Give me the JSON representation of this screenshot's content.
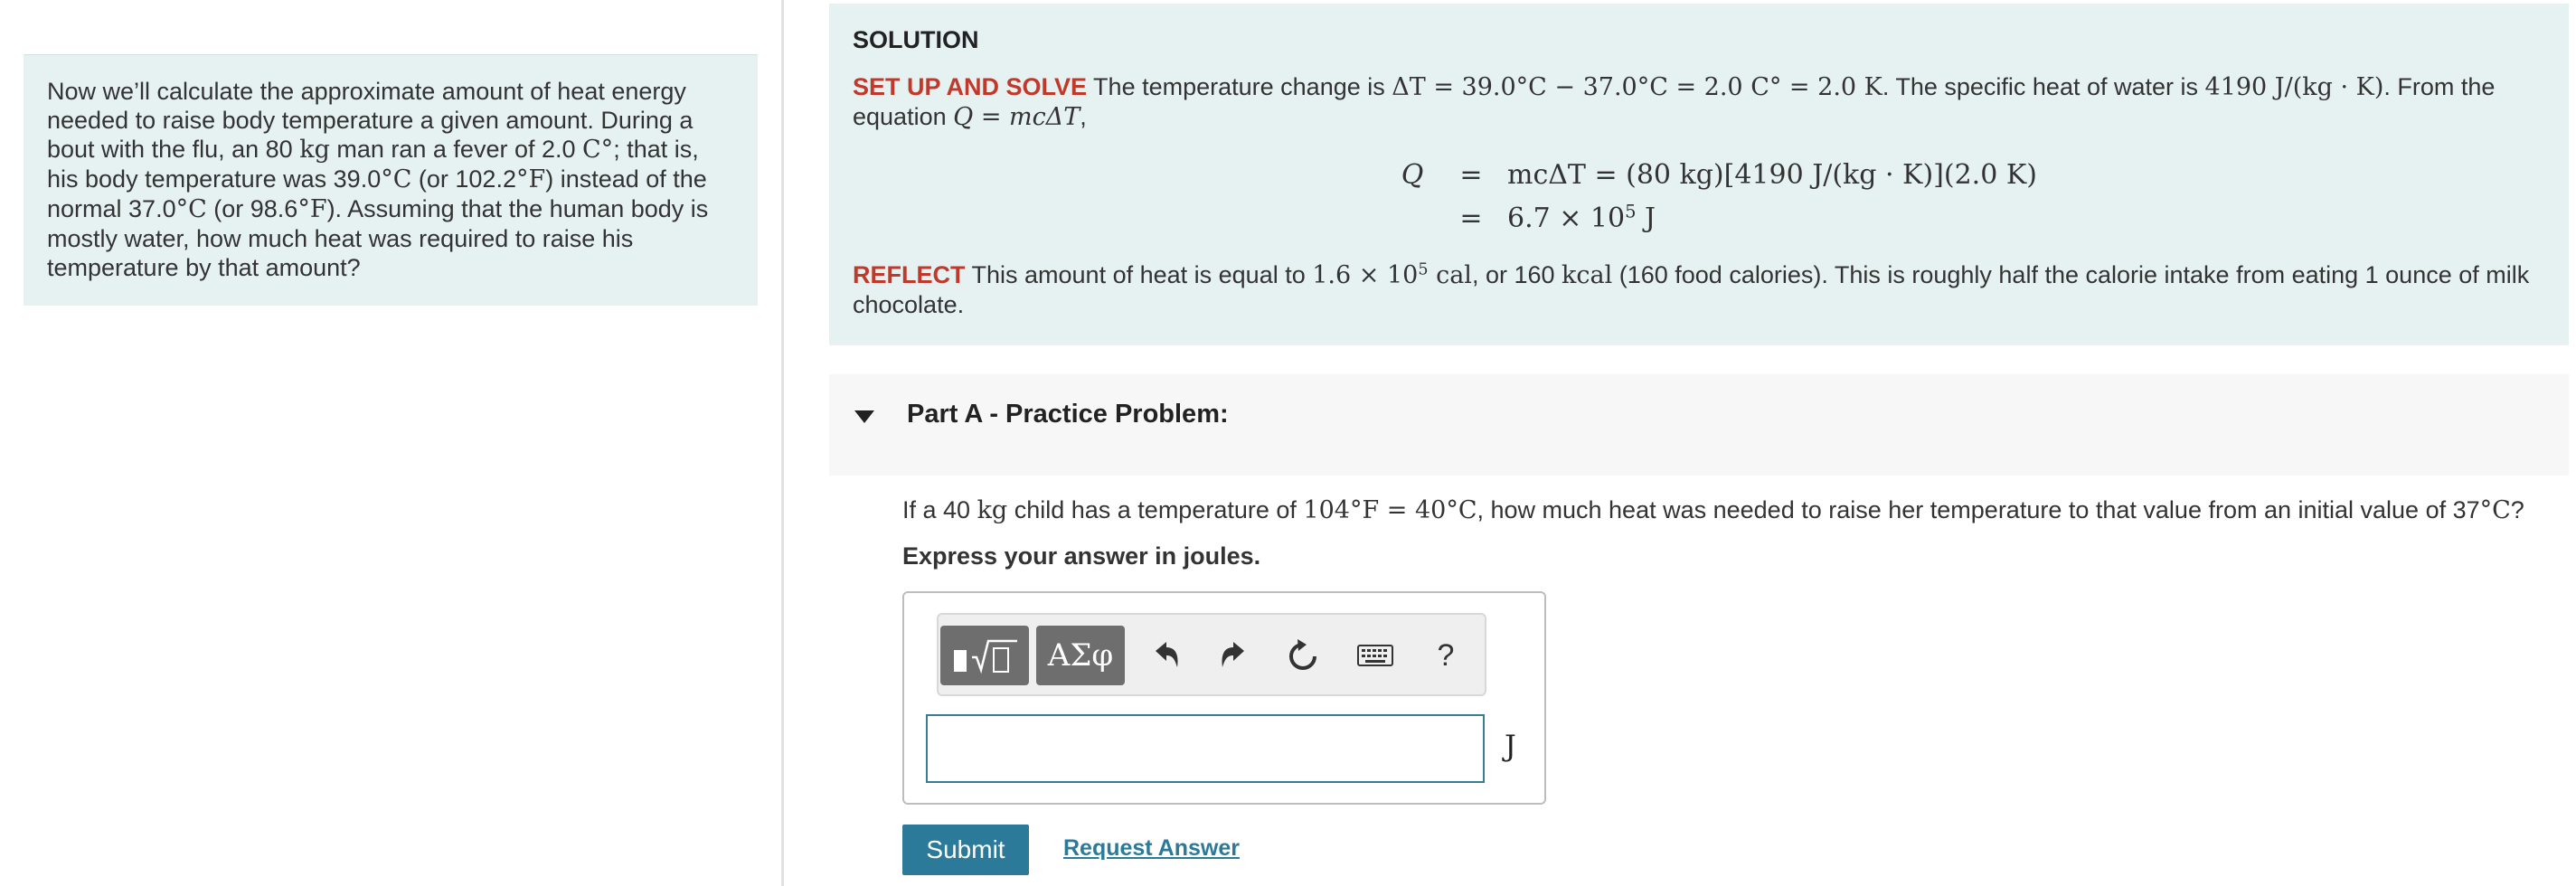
{
  "problem": {
    "t1": "Now we’ll calculate the approximate amount of heat energy needed to raise body temperature a given amount. During a bout with the flu, an 80 ",
    "kg": "kg",
    "t2": " man ran a fever of 2.0 ",
    "cdeg": "C°",
    "t3": "; that is, his body temperature was 39.0",
    "degC1": "°C",
    "t4": " (or 102.2",
    "degF": "°F",
    "t5": ") instead of the normal 37.0",
    "degC2": "°C",
    "t6": " (or 98.6",
    "degF2": "°F",
    "t7": "). Assuming that the human body is mostly water, how much heat was required to raise his temperature by that amount?"
  },
  "solution": {
    "title": "SOLUTION",
    "setup_label": "SET UP AND SOLVE",
    "setup_t1": " The temperature change is ",
    "delta_expr": "ΔT = 39.0°C − 37.0°C = 2.0 C° = 2.0 K",
    "setup_t2": ". The specific heat of water is ",
    "c_expr": "4190 J/(kg · K)",
    "setup_t3": ". From the equation ",
    "eq_inline": "Q = mcΔT",
    "setup_t4": ",",
    "eq_lhs": "Q",
    "eq_op1": "=",
    "eq_rhs1": "mcΔT = (80 kg)[4190 J/(kg · K)](2.0 K)",
    "eq_op2": "=",
    "eq_rhs2_base": "6.7 × 10",
    "eq_rhs2_exp": "5",
    "eq_rhs2_unit": " J",
    "reflect_label": "REFLECT",
    "reflect_t1": " This amount of heat is equal to ",
    "reflect_val_base": "1.6 × 10",
    "reflect_val_exp": "5",
    "reflect_val_unit": " cal",
    "reflect_t2": ", or 160 ",
    "kcal": "kcal",
    "reflect_t3": " (160 food calories). This is roughly half the calorie intake from eating 1 ounce of milk chocolate."
  },
  "partA": {
    "title": "Part A - Practice Problem:",
    "q_t1": "If a 40 ",
    "q_kg": "kg",
    "q_t2": " child has a temperature of ",
    "q_temp": "104°F = 40°C",
    "q_t3": ", how much heat was needed to raise her temperature to that value from an initial value of 37",
    "q_degC": "°C",
    "q_t4": "?",
    "express": "Express your answer in joules.",
    "unit": "J",
    "symbols_label": "ΑΣφ",
    "help_label": "?",
    "submit": "Submit",
    "request": "Request Answer"
  }
}
